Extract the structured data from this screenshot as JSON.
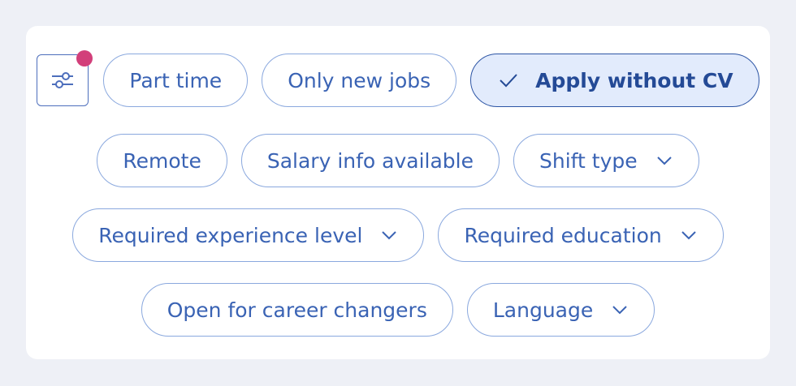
{
  "filters": {
    "settings_icon": "sliders-icon",
    "has_active_filters": true,
    "indicator_color": "#d23f7a",
    "accent_color": "#3a63b4",
    "chips": {
      "part_time": "Part time",
      "only_new_jobs": "Only new jobs",
      "apply_without_cv": "Apply without CV",
      "remote": "Remote",
      "salary_info": "Salary info available",
      "shift_type": "Shift type",
      "experience_level": "Required experience level",
      "education": "Required education",
      "career_changers": "Open for career changers",
      "language": "Language"
    },
    "selected": [
      "apply_without_cv"
    ]
  }
}
